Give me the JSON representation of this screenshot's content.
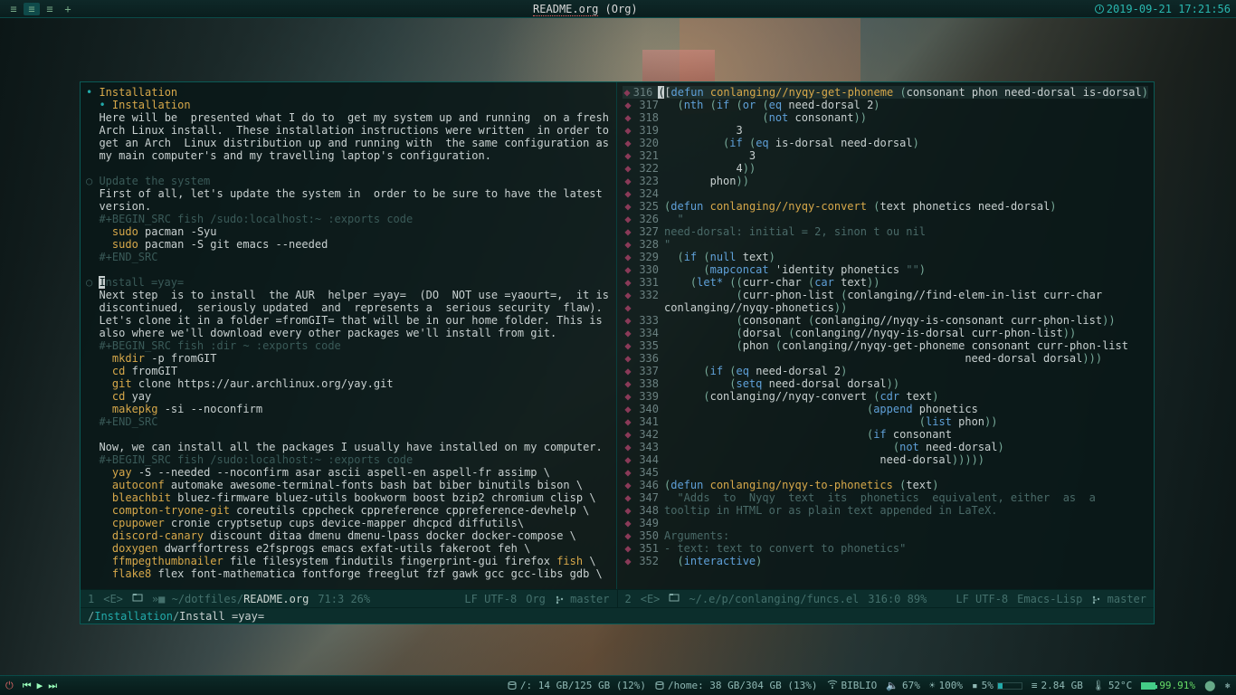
{
  "titlebar": {
    "title_left": "README.org",
    "title_right": "(Org)",
    "clock": "2019-09-21 17:21:56"
  },
  "left_pane": {
    "h1": "Installation",
    "h2": "Installation",
    "intro": "Here will be  presented what I do to  get my system up and running  on a fresh\nArch Linux install.  These installation instructions were written  in order to\nget an Arch  Linux distribution up and running with  the same configuration as\nmy main computer's and my travelling laptop's configuration.",
    "update_h": "Update the system",
    "update_body": "First of all, let's update the system in  order to be sure to have the latest\nversion.",
    "src1_begin": "#+BEGIN_SRC fish /sudo:localhost:~ :exports code",
    "src1_l1a": "sudo",
    "src1_l1b": " pacman -Syu",
    "src1_l2a": "sudo",
    "src1_l2b": " pacman -S git emacs --needed",
    "src_end": "#+END_SRC",
    "yay_cursor_char": "I",
    "yay_h_rest": "nstall =yay=",
    "yay_body": "Next step  is to install  the AUR  helper =yay=  (DO  NOT use =yaourt=,  it is\ndiscontinued,  seriously updated  and  represents a  serious security  flaw).\nLet's clone it in a folder =fromGIT= that will be in our home folder. This is\nalso where we'll download every other packages we'll install from git.",
    "src2_begin": "#+BEGIN_SRC fish :dir ~ :exports code",
    "src2_l1a": "mkdir",
    "src2_l1b": " -p fromGIT",
    "src2_l2a": "cd",
    "src2_l2b": " fromGIT",
    "src2_l3a": "git",
    "src2_l3b": " clone https://aur.archlinux.org/yay.git",
    "src2_l4a": "cd",
    "src2_l4b": " yay",
    "src2_l5a": "makepkg",
    "src2_l5b": " -si --noconfirm",
    "pkg_intro": "Now, we can install all the packages I usually have installed on my computer.",
    "src3_begin": "#+BEGIN_SRC fish /sudo:localhost:~ :exports code",
    "pkg_l1a": "yay",
    "pkg_l1b": " -S --needed --noconfirm asar ascii aspell-en aspell-fr assimp \\",
    "pkg_l2a": "autoconf",
    "pkg_l2b": " automake awesome-terminal-fonts bash bat biber binutils bison \\",
    "pkg_l3a": "bleachbit",
    "pkg_l3b": " bluez-firmware bluez-utils bookworm boost bzip2 chromium clisp \\",
    "pkg_l4a": "compton-tryone-git",
    "pkg_l4b": " coreutils cppcheck cppreference cppreference-devhelp \\",
    "pkg_l5a": "cpupower",
    "pkg_l5b": " cronie cryptsetup cups device-mapper dhcpcd diffutils\\",
    "pkg_l6a": "discord-canary",
    "pkg_l6b": " discount ditaa dmenu dmenu-lpass docker docker-compose \\",
    "pkg_l7a": "doxygen",
    "pkg_l7b": " dwarffortress e2fsprogs emacs exfat-utils fakeroot feh \\",
    "pkg_l8a": "ffmpegthumbnailer",
    "pkg_l8b": " file filesystem findutils fingerprint-gui firefox ",
    "pkg_l8c": "fish",
    "pkg_l8d": " \\",
    "pkg_l9a": "flake8",
    "pkg_l9b": " flex font-mathematica fontforge freeglut fzf gawk gcc gcc-libs gdb \\"
  },
  "right_pane": {
    "lines": [
      {
        "n": 316,
        "seg": [
          [
            "sym",
            "["
          ],
          [
            "kw",
            "defun "
          ],
          [
            "fn",
            "conlanging//nyqy-get-phoneme"
          ],
          [
            "sym",
            " "
          ],
          [
            "paren",
            "("
          ],
          [
            "sym",
            "consonant phon need-dorsal is-dorsal"
          ],
          [
            "paren",
            ")"
          ]
        ]
      },
      {
        "n": 317,
        "seg": [
          [
            "sym",
            "  "
          ],
          [
            "paren",
            "("
          ],
          [
            "kw",
            "nth "
          ],
          [
            "paren",
            "("
          ],
          [
            "kw",
            "if "
          ],
          [
            "paren",
            "("
          ],
          [
            "kw",
            "or "
          ],
          [
            "paren",
            "("
          ],
          [
            "kw",
            "eq "
          ],
          [
            "sym",
            "need-dorsal "
          ],
          [
            "num",
            "2"
          ],
          [
            "paren",
            ")"
          ]
        ]
      },
      {
        "n": 318,
        "seg": [
          [
            "sym",
            "               "
          ],
          [
            "paren",
            "("
          ],
          [
            "kw",
            "not "
          ],
          [
            "sym",
            "consonant"
          ],
          [
            "paren",
            "))"
          ]
        ]
      },
      {
        "n": 319,
        "seg": [
          [
            "sym",
            "           "
          ],
          [
            "num",
            "3"
          ]
        ]
      },
      {
        "n": 320,
        "seg": [
          [
            "sym",
            "         "
          ],
          [
            "paren",
            "("
          ],
          [
            "kw",
            "if "
          ],
          [
            "paren",
            "("
          ],
          [
            "kw",
            "eq "
          ],
          [
            "sym",
            "is-dorsal need-dorsal"
          ],
          [
            "paren",
            ")"
          ]
        ]
      },
      {
        "n": 321,
        "seg": [
          [
            "sym",
            "             "
          ],
          [
            "num",
            "3"
          ]
        ]
      },
      {
        "n": 322,
        "seg": [
          [
            "sym",
            "           "
          ],
          [
            "num",
            "4"
          ],
          [
            "paren",
            "))"
          ]
        ]
      },
      {
        "n": 323,
        "seg": [
          [
            "sym",
            "       phon"
          ],
          [
            "paren",
            "))"
          ]
        ]
      },
      {
        "n": 324,
        "seg": [
          [
            "sym",
            ""
          ]
        ]
      },
      {
        "n": 325,
        "seg": [
          [
            "paren",
            "("
          ],
          [
            "kw",
            "defun "
          ],
          [
            "fn",
            "conlanging//nyqy-convert"
          ],
          [
            "sym",
            " "
          ],
          [
            "paren",
            "("
          ],
          [
            "sym",
            "text phonetics need-dorsal"
          ],
          [
            "paren",
            ")"
          ]
        ]
      },
      {
        "n": 326,
        "seg": [
          [
            "str",
            "  \""
          ]
        ]
      },
      {
        "n": 327,
        "seg": [
          [
            "str",
            "need-dorsal: initial = 2, sinon t ou nil"
          ]
        ]
      },
      {
        "n": 328,
        "seg": [
          [
            "str",
            "\""
          ]
        ]
      },
      {
        "n": 329,
        "seg": [
          [
            "sym",
            "  "
          ],
          [
            "paren",
            "("
          ],
          [
            "kw",
            "if "
          ],
          [
            "paren",
            "("
          ],
          [
            "kw",
            "null "
          ],
          [
            "sym",
            "text"
          ],
          [
            "paren",
            ")"
          ]
        ]
      },
      {
        "n": 330,
        "seg": [
          [
            "sym",
            "      "
          ],
          [
            "paren",
            "("
          ],
          [
            "kw",
            "mapconcat "
          ],
          [
            "sym",
            "'identity phonetics "
          ],
          [
            "str",
            "\"\""
          ],
          [
            "paren",
            ")"
          ]
        ]
      },
      {
        "n": 331,
        "seg": [
          [
            "sym",
            "    "
          ],
          [
            "paren",
            "("
          ],
          [
            "kw",
            "let* "
          ],
          [
            "paren",
            "(("
          ],
          [
            "sym",
            "curr-char "
          ],
          [
            "paren",
            "("
          ],
          [
            "kw",
            "car "
          ],
          [
            "sym",
            "text"
          ],
          [
            "paren",
            "))"
          ]
        ]
      },
      {
        "n": 332,
        "seg": [
          [
            "sym",
            "           "
          ],
          [
            "paren",
            "("
          ],
          [
            "sym",
            "curr-phon-list "
          ],
          [
            "paren",
            "("
          ],
          [
            "sym",
            "conlanging//find-elem-in-list curr-char"
          ]
        ]
      },
      {
        "n": 0,
        "seg": [
          [
            "sym",
            "conlanging//nyqy-phonetics"
          ],
          [
            "paren",
            "))"
          ]
        ],
        "continuation": true
      },
      {
        "n": 333,
        "seg": [
          [
            "sym",
            "           "
          ],
          [
            "paren",
            "("
          ],
          [
            "sym",
            "consonant "
          ],
          [
            "paren",
            "("
          ],
          [
            "sym",
            "conlanging//nyqy-is-consonant curr-phon-list"
          ],
          [
            "paren",
            "))"
          ]
        ]
      },
      {
        "n": 334,
        "seg": [
          [
            "sym",
            "           "
          ],
          [
            "paren",
            "("
          ],
          [
            "sym",
            "dorsal "
          ],
          [
            "paren",
            "("
          ],
          [
            "sym",
            "conlanging//nyqy-is-dorsal curr-phon-list"
          ],
          [
            "paren",
            "))"
          ]
        ]
      },
      {
        "n": 335,
        "seg": [
          [
            "sym",
            "           "
          ],
          [
            "paren",
            "("
          ],
          [
            "sym",
            "phon "
          ],
          [
            "paren",
            "("
          ],
          [
            "sym",
            "conlanging//nyqy-get-phoneme consonant curr-phon-list"
          ]
        ]
      },
      {
        "n": 336,
        "seg": [
          [
            "sym",
            "                                              need-dorsal dorsal"
          ],
          [
            "paren",
            ")))"
          ]
        ]
      },
      {
        "n": 337,
        "seg": [
          [
            "sym",
            "      "
          ],
          [
            "paren",
            "("
          ],
          [
            "kw",
            "if "
          ],
          [
            "paren",
            "("
          ],
          [
            "kw",
            "eq "
          ],
          [
            "sym",
            "need-dorsal "
          ],
          [
            "num",
            "2"
          ],
          [
            "paren",
            ")"
          ]
        ]
      },
      {
        "n": 338,
        "seg": [
          [
            "sym",
            "          "
          ],
          [
            "paren",
            "("
          ],
          [
            "kw",
            "setq "
          ],
          [
            "sym",
            "need-dorsal dorsal"
          ],
          [
            "paren",
            "))"
          ]
        ]
      },
      {
        "n": 339,
        "seg": [
          [
            "sym",
            "      "
          ],
          [
            "paren",
            "("
          ],
          [
            "sym",
            "conlanging//nyqy-convert "
          ],
          [
            "paren",
            "("
          ],
          [
            "kw",
            "cdr "
          ],
          [
            "sym",
            "text"
          ],
          [
            "paren",
            ")"
          ]
        ]
      },
      {
        "n": 340,
        "seg": [
          [
            "sym",
            "                               "
          ],
          [
            "paren",
            "("
          ],
          [
            "kw",
            "append "
          ],
          [
            "sym",
            "phonetics"
          ]
        ]
      },
      {
        "n": 341,
        "seg": [
          [
            "sym",
            "                                       "
          ],
          [
            "paren",
            "("
          ],
          [
            "kw",
            "list "
          ],
          [
            "sym",
            "phon"
          ],
          [
            "paren",
            "))"
          ]
        ]
      },
      {
        "n": 342,
        "seg": [
          [
            "sym",
            "                               "
          ],
          [
            "paren",
            "("
          ],
          [
            "kw",
            "if "
          ],
          [
            "sym",
            "consonant"
          ]
        ]
      },
      {
        "n": 343,
        "seg": [
          [
            "sym",
            "                                   "
          ],
          [
            "paren",
            "("
          ],
          [
            "kw",
            "not "
          ],
          [
            "sym",
            "need-dorsal"
          ],
          [
            "paren",
            ")"
          ]
        ]
      },
      {
        "n": 344,
        "seg": [
          [
            "sym",
            "                                 need-dorsal"
          ],
          [
            "paren",
            ")))))"
          ]
        ]
      },
      {
        "n": 345,
        "seg": [
          [
            "sym",
            ""
          ]
        ]
      },
      {
        "n": 346,
        "seg": [
          [
            "paren",
            "("
          ],
          [
            "kw",
            "defun "
          ],
          [
            "fn",
            "conlanging/nyqy-to-phonetics"
          ],
          [
            "sym",
            " "
          ],
          [
            "paren",
            "("
          ],
          [
            "sym",
            "text"
          ],
          [
            "paren",
            ")"
          ]
        ]
      },
      {
        "n": 347,
        "seg": [
          [
            "str",
            "  \"Adds  to  Nyqy  text  its  phonetics  equivalent, either  as  a"
          ]
        ]
      },
      {
        "n": 348,
        "seg": [
          [
            "str",
            "tooltip in HTML or as plain text appended in LaTeX."
          ]
        ]
      },
      {
        "n": 349,
        "seg": [
          [
            "str",
            ""
          ]
        ]
      },
      {
        "n": 350,
        "seg": [
          [
            "str",
            "Arguments:"
          ]
        ]
      },
      {
        "n": 351,
        "seg": [
          [
            "str",
            "- text: text to convert to phonetics\""
          ]
        ]
      },
      {
        "n": 352,
        "seg": [
          [
            "sym",
            "  "
          ],
          [
            "paren",
            "("
          ],
          [
            "kw",
            "interactive"
          ],
          [
            "paren",
            ")"
          ]
        ]
      }
    ]
  },
  "modeline_left": {
    "winnum": "1",
    "evil": "<E>",
    "path_prefix": "»■ ~/dotfiles/",
    "filename": "README.org",
    "pos": "71:3 26%",
    "lf": "LF UTF-8",
    "mode": "Org",
    "branch": "master"
  },
  "modeline_right": {
    "winnum": "2",
    "evil": "<E>",
    "path": "~/.e/p/conlanging/funcs.el",
    "pos": "316:0 89%",
    "lf": "LF UTF-8",
    "mode": "Emacs-Lisp",
    "branch": "master"
  },
  "breadcrumb": {
    "seg1": "Installation",
    "seg2": "Install =yay="
  },
  "taskbar": {
    "disk_root": "/: 14 GB/125 GB (12%)",
    "disk_home": "/home: 38 GB/304 GB (13%)",
    "wifi": "BIBLIO",
    "volume": "67%",
    "brightness": "100%",
    "cpu": "5%",
    "ram": "2.84 GB",
    "temp": "52°C",
    "battery": "99.91%"
  }
}
